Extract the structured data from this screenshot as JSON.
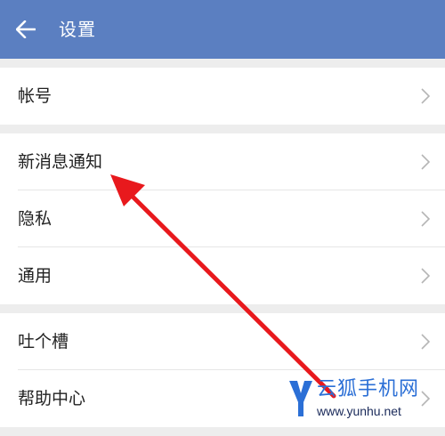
{
  "header": {
    "title": "设置",
    "back_icon": "arrow-left-icon",
    "background_color": "#5b7fc1"
  },
  "settings_groups": [
    {
      "items": [
        {
          "label": "帐号"
        }
      ]
    },
    {
      "items": [
        {
          "label": "新消息通知"
        },
        {
          "label": "隐私"
        },
        {
          "label": "通用"
        }
      ]
    },
    {
      "items": [
        {
          "label": "吐个槽"
        },
        {
          "label": "帮助中心"
        }
      ]
    }
  ],
  "annotation": {
    "type": "arrow",
    "color": "#e8191d",
    "points_to": "新消息通知"
  },
  "watermark": {
    "title": "云狐手机网",
    "url": "www.yunhu.net",
    "logo_letter": "Y"
  }
}
